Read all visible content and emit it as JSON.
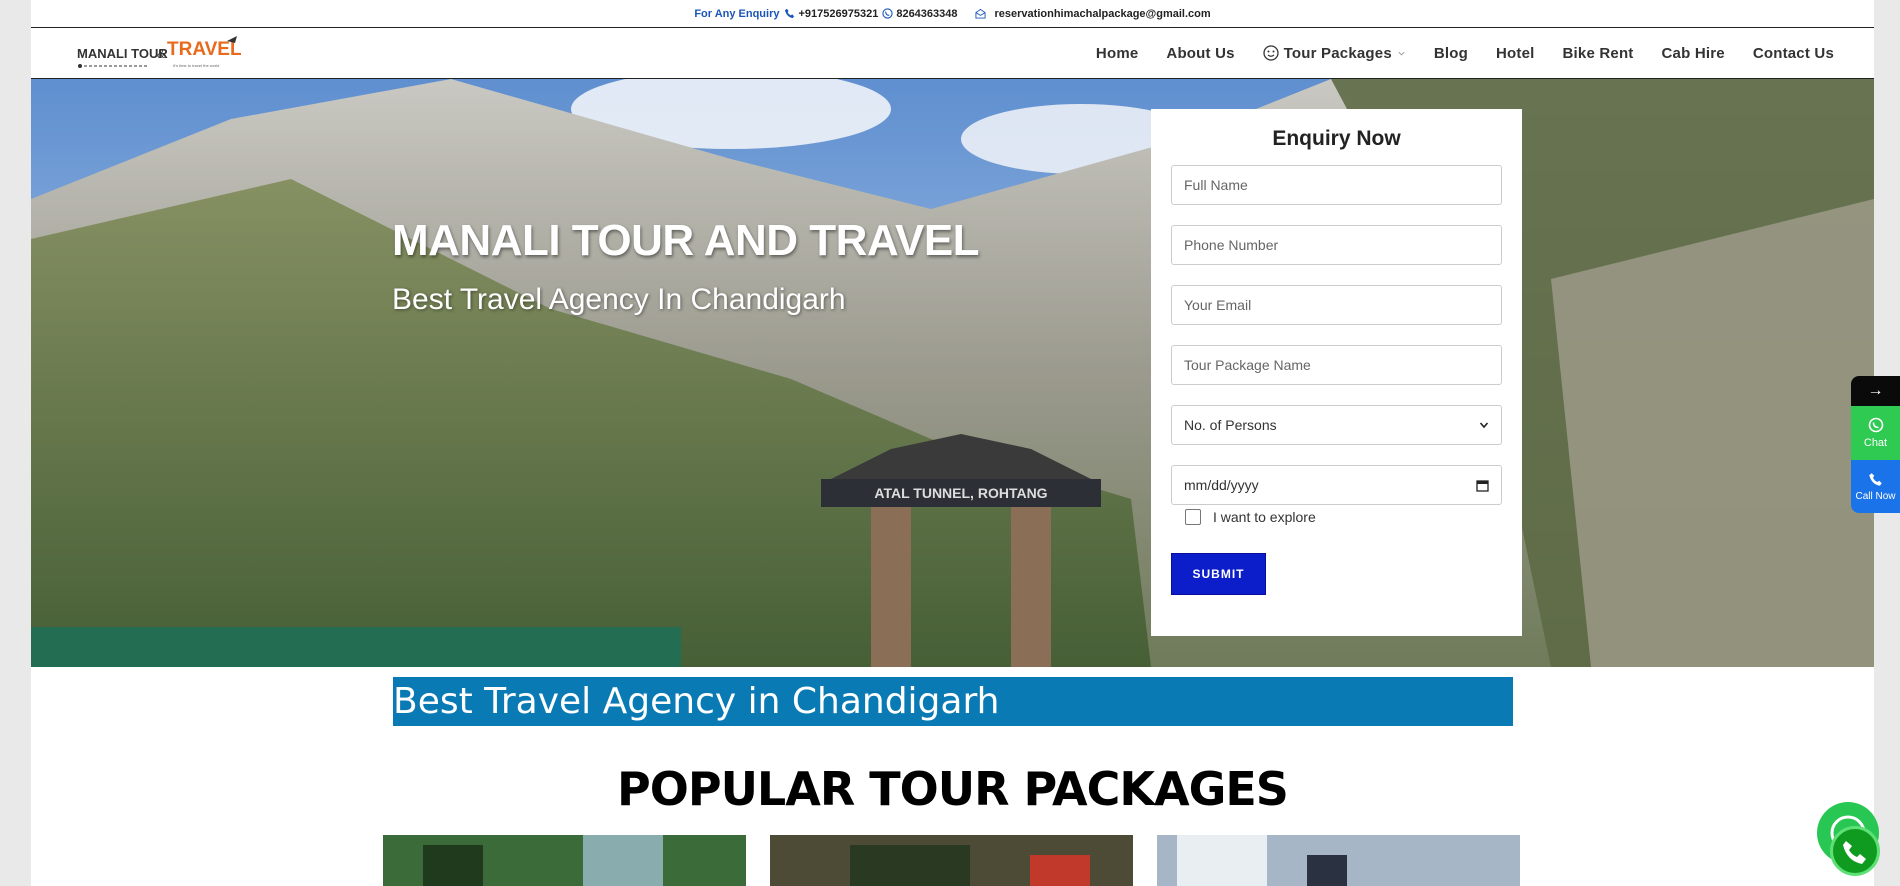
{
  "topbar": {
    "enquiry_label": "For Any Enquiry",
    "phone1": "+917526975321",
    "phone2": "8264363348",
    "email": "reservationhimachalpackage@gmail.com"
  },
  "logo": {
    "text_left": "MANALI TOUR",
    "amp": "&",
    "text_right": "TRAVEL",
    "tagline": "It's time to travel the world"
  },
  "nav": {
    "items": [
      "Home",
      "About Us",
      "Tour Packages",
      "Blog",
      "Hotel",
      "Bike Rent",
      "Cab Hire",
      "Contact Us"
    ]
  },
  "hero": {
    "title": "MANALI TOUR AND TRAVEL",
    "subtitle": "Best Travel Agency In Chandigarh",
    "gate_text": "ATAL TUNNEL, ROHTANG"
  },
  "enquiry": {
    "title": "Enquiry Now",
    "full_name_placeholder": "Full Name",
    "phone_placeholder": "Phone Number",
    "email_placeholder": "Your Email",
    "package_placeholder": "Tour Package Name",
    "persons_selected": "No. of Persons",
    "date_placeholder": "mm/dd/yyyy",
    "checkbox_label": "I want to explore",
    "submit_label": "SUBMIT"
  },
  "banner": {
    "text": "Best Travel Agency in Chandigarh"
  },
  "section": {
    "title": "POPULAR TOUR PACKAGES"
  },
  "side_widget": {
    "arrow": "→",
    "chat_label": "Chat",
    "call_label": "Call Now"
  },
  "colors": {
    "accent_blue": "#0a7ab4",
    "submit_blue": "#0c1ec9",
    "whatsapp_green": "#2fca52",
    "call_blue": "#1a73e8",
    "logo_orange": "#e86a1c"
  }
}
